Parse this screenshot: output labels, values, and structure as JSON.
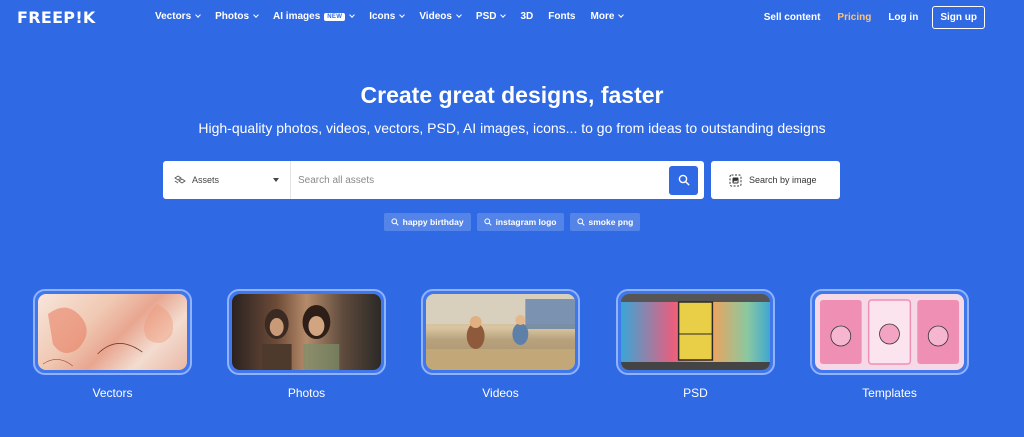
{
  "nav": {
    "logo": "FREEP!K",
    "menu": [
      {
        "label": "Vectors",
        "dropdown": true
      },
      {
        "label": "Photos",
        "dropdown": true
      },
      {
        "label": "AI images",
        "badge": "NEW",
        "dropdown": true
      },
      {
        "label": "Icons",
        "dropdown": true
      },
      {
        "label": "Videos",
        "dropdown": true
      },
      {
        "label": "PSD",
        "dropdown": true
      },
      {
        "label": "3D",
        "dropdown": false
      },
      {
        "label": "Fonts",
        "dropdown": false
      },
      {
        "label": "More",
        "dropdown": true
      }
    ],
    "sell_content": "Sell content",
    "pricing": "Pricing",
    "login": "Log in",
    "signup": "Sign up"
  },
  "hero": {
    "title": "Create great designs, faster",
    "subtitle": "High-quality photos, videos, vectors, PSD, AI images, icons... to go from ideas to outstanding designs"
  },
  "search": {
    "asset_type": "Assets",
    "placeholder": "Search all assets",
    "by_image_label": "Search by image"
  },
  "suggestions": [
    "happy birthday",
    "instagram logo",
    "smoke png"
  ],
  "categories": [
    {
      "label": "Vectors"
    },
    {
      "label": "Photos"
    },
    {
      "label": "Videos"
    },
    {
      "label": "PSD"
    },
    {
      "label": "Templates"
    }
  ],
  "colors": {
    "background": "#2f69e3",
    "pricing": "#ffc27a",
    "search_button": "#2f69e3"
  }
}
